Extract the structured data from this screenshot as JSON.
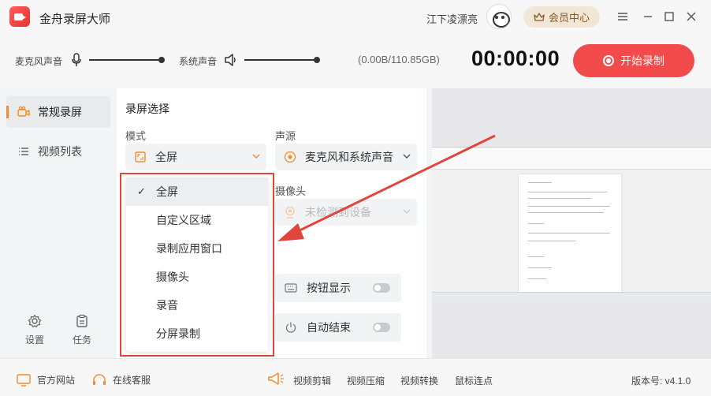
{
  "app": {
    "title": "金舟录屏大师"
  },
  "header": {
    "username": "江下凌漂亮",
    "vip_label": "会员中心"
  },
  "audio": {
    "mic_label": "麦克风声音",
    "system_label": "系统声音",
    "mic_level": 1.0,
    "system_level": 1.0
  },
  "storage": "(0.00B/110.85GB)",
  "timer": "00:00:00",
  "record_button": "开始录制",
  "sidebar": {
    "items": [
      {
        "label": "常规录屏",
        "active": true
      },
      {
        "label": "视频列表",
        "active": false
      }
    ],
    "bottom": [
      {
        "label": "设置"
      },
      {
        "label": "任务"
      }
    ]
  },
  "main": {
    "section_title": "录屏选择",
    "mode_label": "模式",
    "mode_value": "全屏",
    "audio_label": "声源",
    "audio_value": "麦克风和系统声音",
    "camera_label": "摄像头",
    "camera_value": "未检测到设备",
    "button_display_label": "按钮显示",
    "auto_end_label": "自动结束"
  },
  "dropdown": {
    "items": [
      {
        "label": "全屏",
        "selected": true
      },
      {
        "label": "自定义区域",
        "selected": false
      },
      {
        "label": "录制应用窗口",
        "selected": false
      },
      {
        "label": "摄像头",
        "selected": false
      },
      {
        "label": "录音",
        "selected": false
      },
      {
        "label": "分屏录制",
        "selected": false
      }
    ],
    "check_glyph": "✓"
  },
  "footer": {
    "website": "官方网站",
    "support": "在线客服",
    "tools": [
      "视频剪辑",
      "视频压缩",
      "视频转换",
      "鼠标连点"
    ],
    "version": "版本号: v4.1.0"
  },
  "colors": {
    "accent": "#f34b4b",
    "highlight_border": "#e0463b",
    "sidebar_marker": "#f28c2c",
    "vip_bg": "#f2e6d6"
  }
}
